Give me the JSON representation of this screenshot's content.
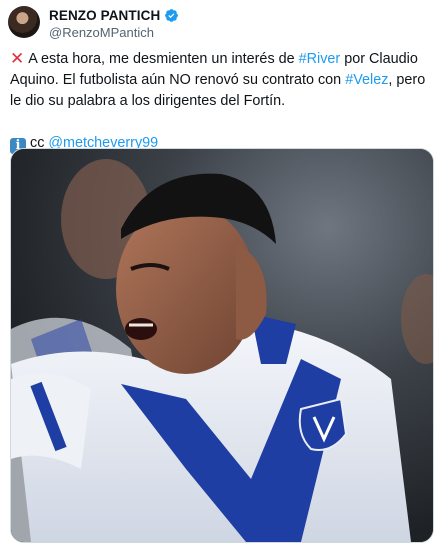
{
  "user": {
    "display_name": "RENZO PANTICH",
    "handle": "@RenzoMPantich",
    "verified_icon": "verified-badge-icon"
  },
  "tweet": {
    "line1_prefix_icon": "cross-mark-icon",
    "text1_a": "A esta hora, me desmienten un interés de ",
    "hashtag_river": "#River",
    "text1_b": " por Claudio Aquino. El futbolista aún NO renovó su contrato con ",
    "hashtag_velez": "#Velez",
    "text1_c": ", pero le dio su palabra a los dirigentes del Fortín.",
    "info_icon_glyph": "i",
    "cc_text": "cc ",
    "mention": "@metcheverry99"
  },
  "media": {
    "image_icon": "soccer-player-celebration-photo"
  },
  "colors": {
    "link": "#1d9bf0",
    "text": "#0f1419",
    "secondary": "#536471",
    "verified": "#1d9bf0"
  }
}
